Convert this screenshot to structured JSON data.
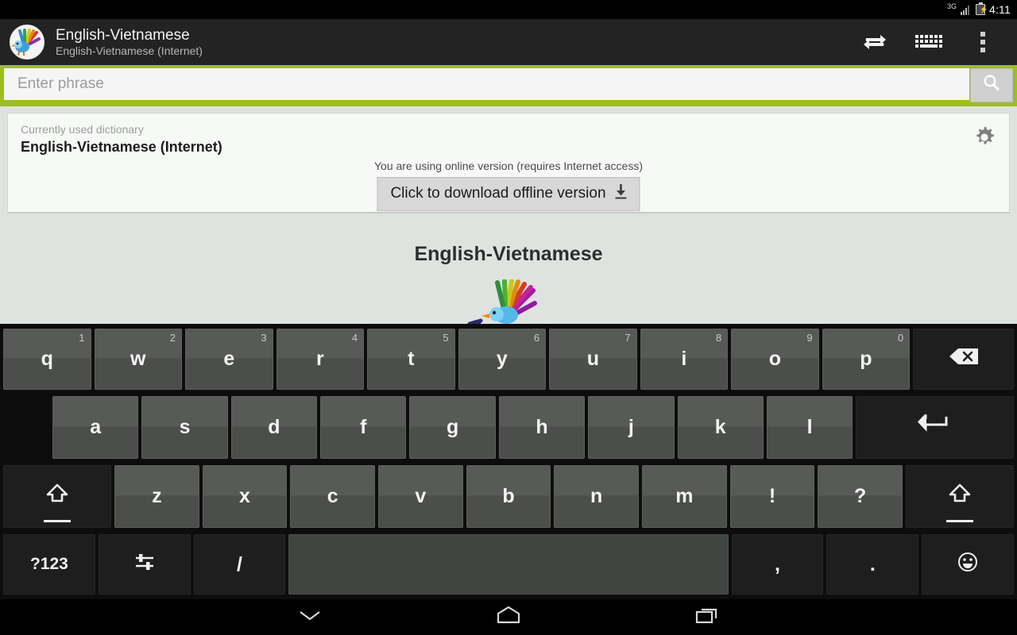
{
  "status_bar": {
    "network_label": "3G",
    "time": "4:11",
    "battery_icon": "battery-charging-icon",
    "signal_icon": "signal-bars-icon"
  },
  "action_bar": {
    "app_icon": "peacock-logo-icon",
    "title": "English-Vietnamese",
    "subtitle": "English-Vietnamese (Internet)",
    "actions": [
      {
        "name": "swap-languages-button",
        "icon": "swap-arrows-icon"
      },
      {
        "name": "keyboard-toggle-button",
        "icon": "keyboard-icon"
      },
      {
        "name": "overflow-menu-button",
        "icon": "more-vertical-icon"
      }
    ]
  },
  "search": {
    "placeholder": "Enter phrase",
    "value": "",
    "button_icon": "search-icon",
    "accent_color": "#9dbf1b"
  },
  "dictionary_card": {
    "label": "Currently used dictionary",
    "title": "English-Vietnamese (Internet)",
    "settings_icon": "gear-icon",
    "online_note": "You are using online version (requires Internet access)",
    "download_button_label": "Click to download offline version",
    "download_button_icon": "download-arrow-icon"
  },
  "main": {
    "title": "English-Vietnamese",
    "illustration": "peacock-bird-illustration"
  },
  "keyboard": {
    "row1": [
      {
        "label": "q",
        "hint": "1",
        "style": "light"
      },
      {
        "label": "w",
        "hint": "2",
        "style": "light"
      },
      {
        "label": "e",
        "hint": "3",
        "style": "light"
      },
      {
        "label": "r",
        "hint": "4",
        "style": "light"
      },
      {
        "label": "t",
        "hint": "5",
        "style": "light"
      },
      {
        "label": "y",
        "hint": "6",
        "style": "light"
      },
      {
        "label": "u",
        "hint": "7",
        "style": "light"
      },
      {
        "label": "i",
        "hint": "8",
        "style": "light"
      },
      {
        "label": "o",
        "hint": "9",
        "style": "light"
      },
      {
        "label": "p",
        "hint": "0",
        "style": "light"
      },
      {
        "label": "",
        "icon": "backspace-icon",
        "name": "key-backspace",
        "style": "dark"
      }
    ],
    "row2": [
      {
        "label": "a",
        "style": "light"
      },
      {
        "label": "s",
        "style": "light"
      },
      {
        "label": "d",
        "style": "light"
      },
      {
        "label": "f",
        "style": "light"
      },
      {
        "label": "g",
        "style": "light"
      },
      {
        "label": "h",
        "style": "light"
      },
      {
        "label": "j",
        "style": "light"
      },
      {
        "label": "k",
        "style": "light"
      },
      {
        "label": "l",
        "style": "light"
      },
      {
        "label": "",
        "icon": "enter-icon",
        "name": "key-enter",
        "style": "dark"
      }
    ],
    "row3": [
      {
        "label": "",
        "icon": "shift-icon",
        "name": "key-shift-left",
        "style": "dark"
      },
      {
        "label": "z",
        "style": "light"
      },
      {
        "label": "x",
        "style": "light"
      },
      {
        "label": "c",
        "style": "light"
      },
      {
        "label": "v",
        "style": "light"
      },
      {
        "label": "b",
        "style": "light"
      },
      {
        "label": "n",
        "style": "light"
      },
      {
        "label": "m",
        "style": "light"
      },
      {
        "label": "!",
        "style": "light"
      },
      {
        "label": "?",
        "style": "light"
      },
      {
        "label": "",
        "icon": "shift-icon",
        "name": "key-shift-right",
        "style": "dark"
      }
    ],
    "row4": [
      {
        "label": "?123",
        "name": "key-symbols",
        "style": "dark"
      },
      {
        "label": "",
        "icon": "keyboard-settings-icon",
        "name": "key-settings",
        "style": "dark"
      },
      {
        "label": "/",
        "name": "key-slash",
        "style": "dark"
      },
      {
        "label": "",
        "name": "key-space",
        "style": "space"
      },
      {
        "label": ",",
        "name": "key-comma",
        "style": "dark"
      },
      {
        "label": ".",
        "name": "key-period",
        "style": "dark"
      },
      {
        "label": "",
        "icon": "emoji-icon",
        "name": "key-emoji",
        "style": "dark"
      }
    ]
  },
  "nav_bar": [
    {
      "name": "nav-hide-keyboard-button",
      "icon": "chevron-down-icon"
    },
    {
      "name": "nav-home-button",
      "icon": "home-icon"
    },
    {
      "name": "nav-recents-button",
      "icon": "recents-icon"
    }
  ]
}
